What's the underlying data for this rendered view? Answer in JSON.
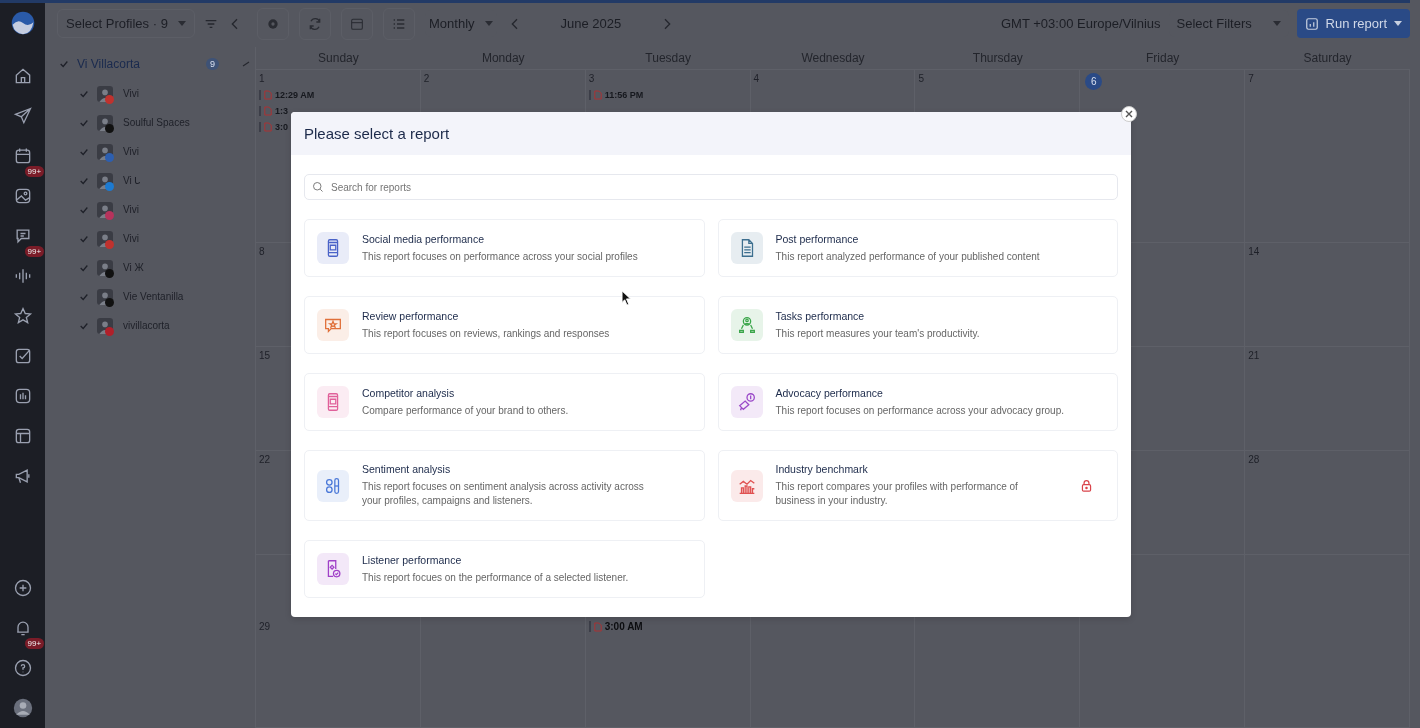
{
  "nav": {
    "calendar_badge": "99+",
    "chat_badge": "99+",
    "bell_badge": "99+"
  },
  "toolbar": {
    "profiles_select": "Select Profiles · 9",
    "view_select": "Monthly",
    "period": "June 2025",
    "timezone": "GMT +03:00 Europe/Vilnius",
    "filters_select": "Select Filters",
    "run_button": "Run report"
  },
  "profiles": {
    "group": {
      "name": "Vi Villacorta",
      "count": "9",
      "checked": true
    },
    "items": [
      {
        "name": "Vivi",
        "checked": true,
        "color": "#c0322e"
      },
      {
        "name": "Soulful Spaces",
        "checked": true,
        "color": "#111111"
      },
      {
        "name": "Vivi",
        "checked": true,
        "color": "#2d5fb0"
      },
      {
        "name": "Vi ᒐ",
        "checked": true,
        "color": "#1d7ad0"
      },
      {
        "name": "Vivi",
        "checked": true,
        "color": "#b6335c"
      },
      {
        "name": "Vivi",
        "checked": true,
        "color": "#c0322e"
      },
      {
        "name": "Vi Ж",
        "checked": true,
        "color": "#111111"
      },
      {
        "name": "Vie Ventanilla",
        "checked": true,
        "color": "#111111"
      },
      {
        "name": "vivillacorta",
        "checked": true,
        "color": "#b0202a"
      }
    ]
  },
  "calendar": {
    "days": [
      "Sunday",
      "Monday",
      "Tuesday",
      "Wednesday",
      "Thursday",
      "Friday",
      "Saturday"
    ],
    "weeks": [
      {
        "sunday": {
          "date": "1",
          "events": [
            "12:29 AM",
            "1:3",
            "3:0"
          ]
        },
        "monday": {
          "date": "2"
        },
        "tuesday": {
          "date": "3",
          "events": [
            "11:56 PM"
          ]
        },
        "wednesday": {
          "date": "4"
        },
        "thursday": {
          "date": "5"
        },
        "friday": {
          "date": "6",
          "today": true
        },
        "saturday": {
          "date": "7"
        }
      },
      {
        "sunday": {
          "date": "8"
        },
        "saturday": {
          "date": "14"
        }
      },
      {
        "sunday": {
          "date": "15"
        },
        "saturday": {
          "date": "21"
        }
      },
      {
        "sunday": {
          "date": "22"
        },
        "saturday": {
          "date": "28"
        }
      },
      {
        "sunday": {
          "date": "29"
        },
        "tuesday": {
          "events": [
            "3:00 AM"
          ]
        }
      }
    ]
  },
  "modal": {
    "title": "Please select a report",
    "search": {
      "placeholder": "Search for reports"
    },
    "reports": [
      {
        "kind": "phone",
        "color": "#4a63c8",
        "title": "Social media performance",
        "description": "This report focuses on performance across your social profiles"
      },
      {
        "kind": "document",
        "color": "#3d6f8f",
        "title": "Post performance",
        "description": "This report analyzed performance of your published content"
      },
      {
        "kind": "review",
        "color": "#e0703a",
        "title": "Review performance",
        "description": "This report focuses on reviews, rankings and responses"
      },
      {
        "kind": "team",
        "color": "#3aa64a",
        "title": "Tasks performance",
        "description": "This report measures your team's productivity."
      },
      {
        "kind": "competitor",
        "color": "#e0609a",
        "title": "Competitor analysis",
        "description": "Compare performance of your brand to others."
      },
      {
        "kind": "megaphone",
        "color": "#9a48c8",
        "title": "Advocacy performance",
        "description": "This report focuses on performance across your advocacy group."
      },
      {
        "kind": "sentiment",
        "color": "#4a78d8",
        "title": "Sentiment analysis",
        "description": "This report focuses on sentiment analysis across activity across your profiles, campaigns and listeners."
      },
      {
        "kind": "benchmark",
        "color": "#e05050",
        "title": "Industry benchmark",
        "description": "This report compares your profiles with performance of business in your industry.",
        "locked": true
      },
      {
        "kind": "listener",
        "color": "#a040c8",
        "title": "Listener performance",
        "description": "This report focues on the performance of a selected listener."
      }
    ]
  }
}
